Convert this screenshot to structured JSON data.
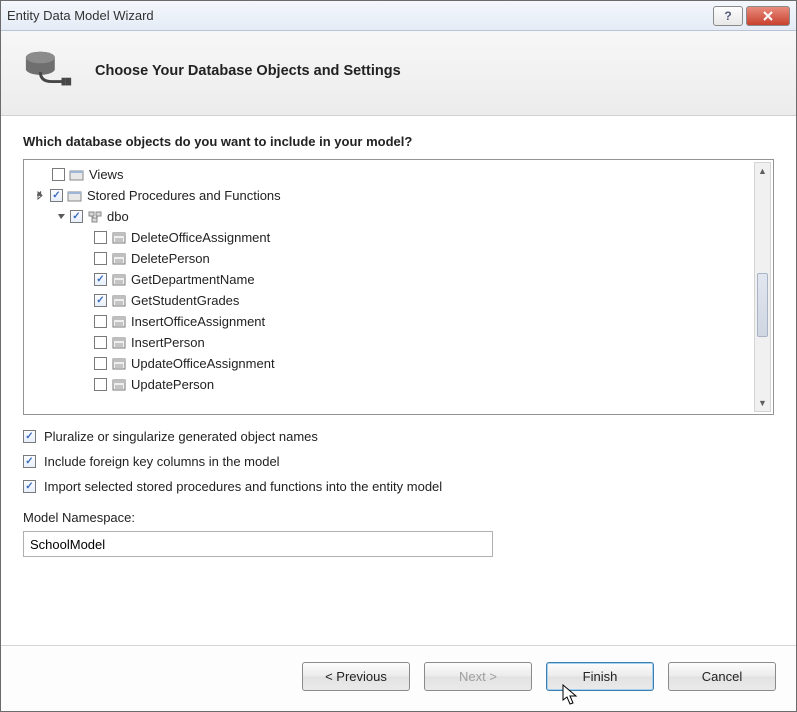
{
  "titlebar": {
    "title": "Entity Data Model Wizard"
  },
  "header": {
    "title": "Choose Your Database Objects and Settings"
  },
  "prompt": "Which database objects do you want to include in your model?",
  "tree": {
    "views_label": "Views",
    "sp_label": "Stored Procedures and Functions",
    "dbo_label": "dbo",
    "items": [
      {
        "label": "DeleteOfficeAssignment",
        "checked": false
      },
      {
        "label": "DeletePerson",
        "checked": false
      },
      {
        "label": "GetDepartmentName",
        "checked": true
      },
      {
        "label": "GetStudentGrades",
        "checked": true
      },
      {
        "label": "InsertOfficeAssignment",
        "checked": false
      },
      {
        "label": "InsertPerson",
        "checked": false
      },
      {
        "label": "UpdateOfficeAssignment",
        "checked": false
      },
      {
        "label": "UpdatePerson",
        "checked": false
      }
    ]
  },
  "options": {
    "pluralize": "Pluralize or singularize generated object names",
    "fk": "Include foreign key columns in the model",
    "import": "Import selected stored procedures and functions into the entity model"
  },
  "model_ns": {
    "label": "Model Namespace:",
    "value": "SchoolModel"
  },
  "buttons": {
    "previous": "< Previous",
    "next": "Next >",
    "finish": "Finish",
    "cancel": "Cancel"
  }
}
